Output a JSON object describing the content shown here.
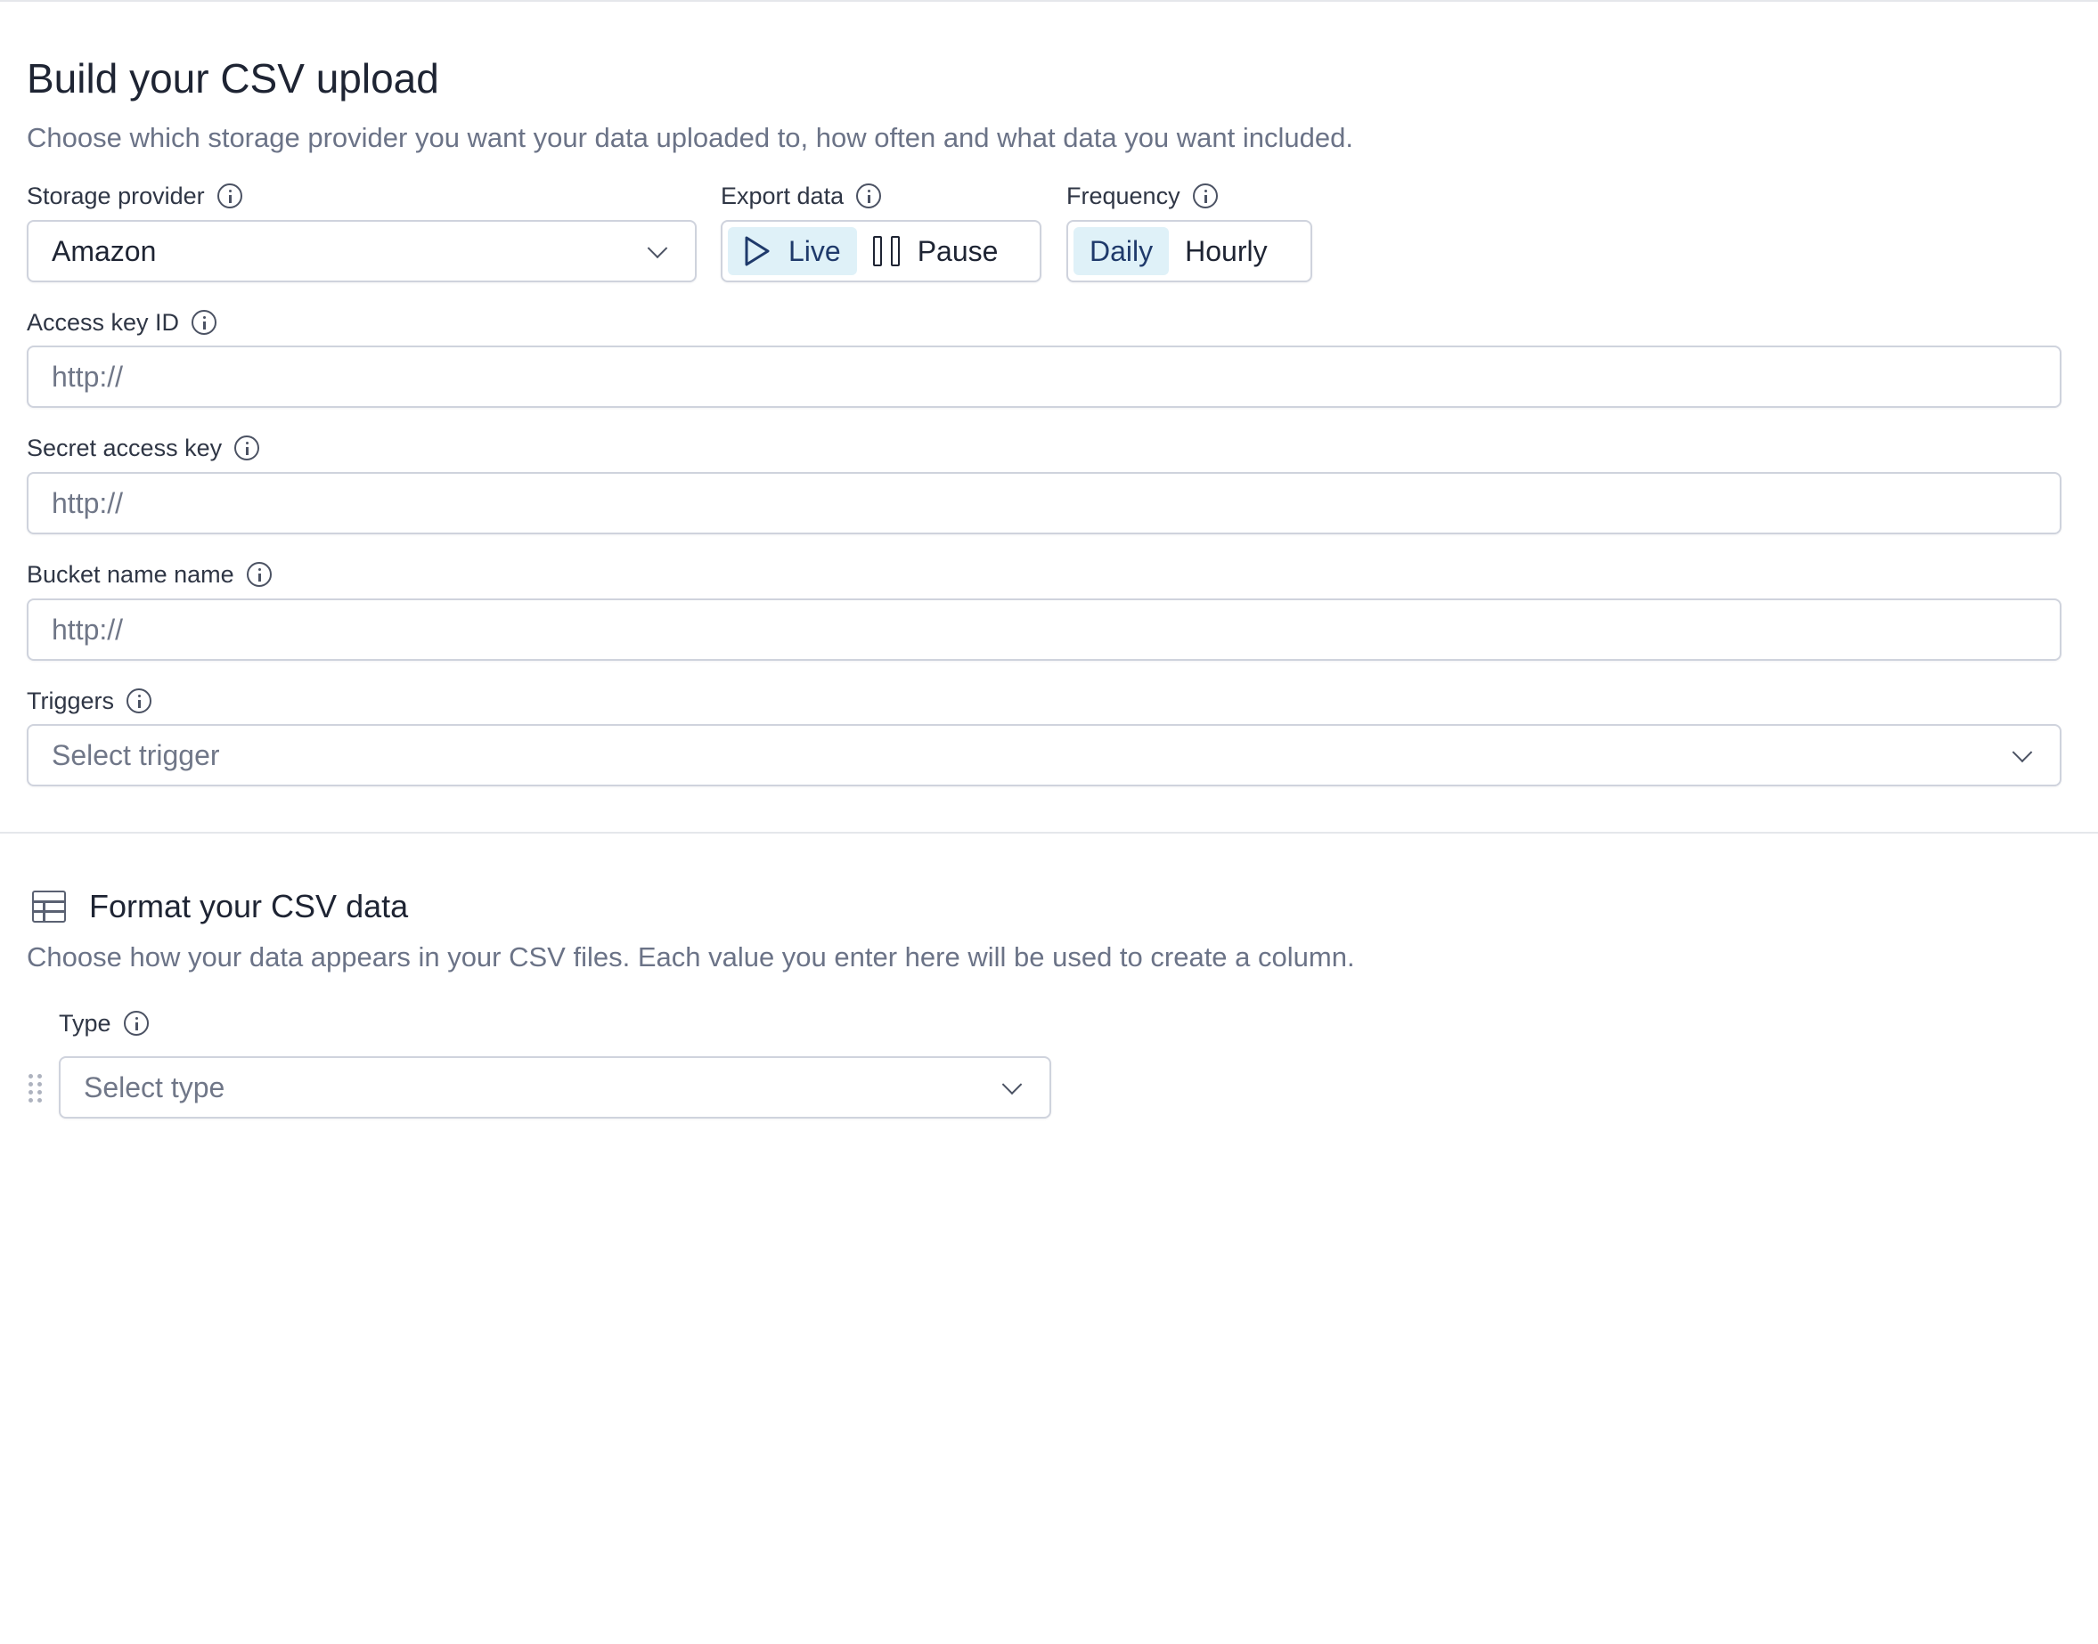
{
  "header": {
    "title": "Build your CSV upload",
    "subtitle": "Choose which storage provider you want your data uploaded to, how often and what data you want included."
  },
  "storage_provider": {
    "label": "Storage provider",
    "value": "Amazon"
  },
  "export_data": {
    "label": "Export data",
    "options": [
      "Live",
      "Pause"
    ],
    "selected": "Live"
  },
  "frequency": {
    "label": "Frequency",
    "options": [
      "Daily",
      "Hourly"
    ],
    "selected": "Daily"
  },
  "access_key": {
    "label": "Access key ID",
    "placeholder": "http://"
  },
  "secret_key": {
    "label": "Secret access key",
    "placeholder": "http://"
  },
  "bucket_name": {
    "label": "Bucket name name",
    "placeholder": "http://"
  },
  "triggers": {
    "label": "Triggers",
    "placeholder": "Select trigger"
  },
  "format_section": {
    "title": "Format your CSV data",
    "description": "Choose how your data appears in your CSV files. Each value you enter here will be used to create a column.",
    "type_label": "Type",
    "type_placeholder": "Select type"
  },
  "colors": {
    "active_segment_bg": "#dff1f8",
    "border": "#cfd3dd",
    "muted_text": "#6b7387"
  }
}
